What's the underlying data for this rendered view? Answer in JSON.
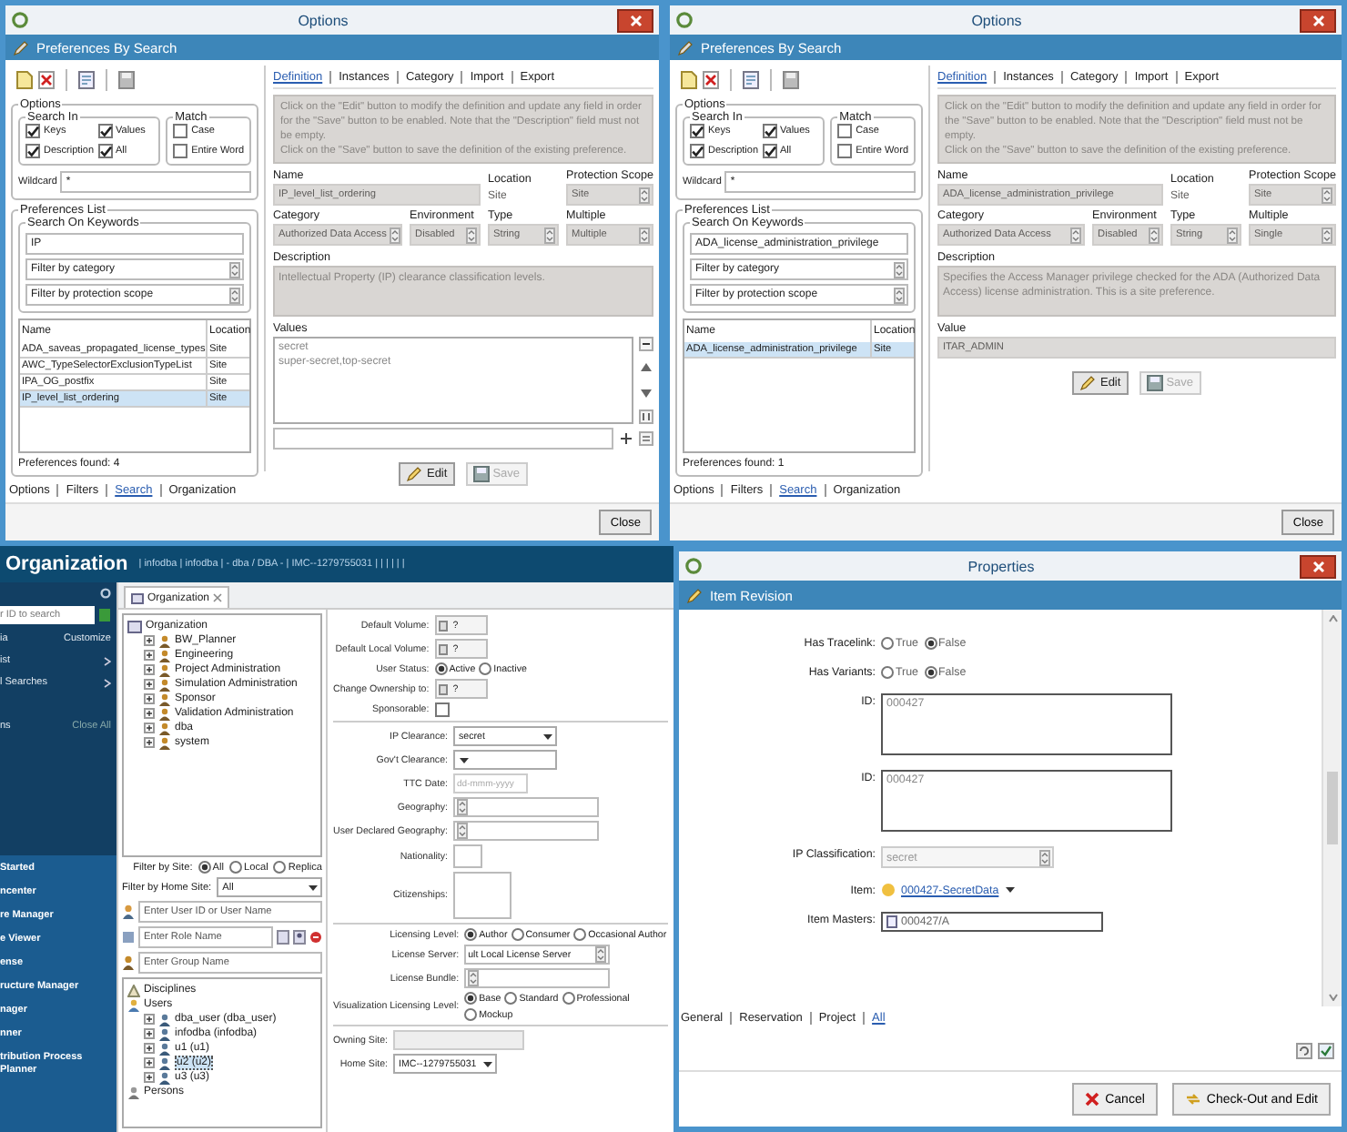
{
  "options_dialogs": [
    {
      "title": "Options",
      "header": "Preferences By Search",
      "options": {
        "legend": "Options",
        "search_in": {
          "legend": "Search In",
          "checks": [
            {
              "label": "Keys",
              "checked": true
            },
            {
              "label": "Values",
              "checked": true
            },
            {
              "label": "Description",
              "checked": true
            },
            {
              "label": "All",
              "checked": true
            }
          ]
        },
        "match": {
          "legend": "Match",
          "checks": [
            {
              "label": "Case",
              "checked": false
            },
            {
              "label": "Entire Word",
              "checked": false
            }
          ]
        },
        "wildcard": {
          "label": "Wildcard",
          "value": "*"
        }
      },
      "prefs": {
        "legend": "Preferences List",
        "search_legend": "Search On Keywords",
        "keyword": "IP",
        "filters": [
          "Filter by category",
          "Filter by protection scope"
        ],
        "columns": [
          "Name",
          "Location"
        ],
        "rows": [
          {
            "name": "ADA_saveas_propagated_license_types",
            "location": "Site",
            "selected": false
          },
          {
            "name": "AWC_TypeSelectorExclusionTypeList",
            "location": "Site",
            "selected": false
          },
          {
            "name": "IPA_OG_postfix",
            "location": "Site",
            "selected": false
          },
          {
            "name": "IP_level_list_ordering",
            "location": "Site",
            "selected": true
          }
        ],
        "found": "Preferences found: 4"
      },
      "tabs": [
        {
          "label": "Definition",
          "selected": true
        },
        {
          "label": "Instances",
          "selected": false
        },
        {
          "label": "Category",
          "selected": false
        },
        {
          "label": "Import",
          "selected": false
        },
        {
          "label": "Export",
          "selected": false
        }
      ],
      "info": [
        "Click on the \"Edit\" button to modify the definition and update any field in order for the \"Save\" button to be enabled. Note that the \"Description\" field must not be empty.",
        "Click on the \"Save\" button to save the definition of the existing preference."
      ],
      "field_rows": [
        [
          {
            "label": "Name",
            "value": "IP_level_list_ordering",
            "kind": "input"
          },
          {
            "label": "Location",
            "value": "Site",
            "kind": "text"
          },
          {
            "label": "Protection Scope",
            "value": "Site",
            "kind": "select"
          }
        ],
        [
          {
            "label": "Category",
            "value": "Authorized Data Access",
            "kind": "select"
          },
          {
            "label": "Environment",
            "value": "Disabled",
            "kind": "select"
          },
          {
            "label": "Type",
            "value": "String",
            "kind": "select"
          },
          {
            "label": "Multiple",
            "value": "Multiple",
            "kind": "select"
          }
        ]
      ],
      "description": {
        "label": "Description",
        "text": "Intellectual Property (IP) clearance classification levels."
      },
      "values": {
        "kind": "list",
        "label": "Values",
        "items": [
          "secret",
          "super-secret,top-secret"
        ]
      },
      "buttons": [
        {
          "kind": "edit",
          "label": "Edit",
          "disabled": false
        },
        {
          "kind": "save",
          "label": "Save",
          "disabled": true
        }
      ],
      "bottom_tabs": [
        {
          "label": "Options",
          "selected": false
        },
        {
          "label": "Filters",
          "selected": false
        },
        {
          "label": "Search",
          "selected": true
        },
        {
          "label": "Organization",
          "selected": false
        }
      ],
      "close": "Close"
    },
    {
      "title": "Options",
      "header": "Preferences By Search",
      "options": {
        "legend": "Options",
        "search_in": {
          "legend": "Search In",
          "checks": [
            {
              "label": "Keys",
              "checked": true
            },
            {
              "label": "Values",
              "checked": true
            },
            {
              "label": "Description",
              "checked": true
            },
            {
              "label": "All",
              "checked": true
            }
          ]
        },
        "match": {
          "legend": "Match",
          "checks": [
            {
              "label": "Case",
              "checked": false
            },
            {
              "label": "Entire Word",
              "checked": false
            }
          ]
        },
        "wildcard": {
          "label": "Wildcard",
          "value": "*"
        }
      },
      "prefs": {
        "legend": "Preferences List",
        "search_legend": "Search On Keywords",
        "keyword": "ADA_license_administration_privilege",
        "filters": [
          "Filter by category",
          "Filter by protection scope"
        ],
        "columns": [
          "Name",
          "Location"
        ],
        "rows": [
          {
            "name": "ADA_license_administration_privilege",
            "location": "Site",
            "selected": true
          }
        ],
        "found": "Preferences found: 1"
      },
      "tabs": [
        {
          "label": "Definition",
          "selected": true
        },
        {
          "label": "Instances",
          "selected": false
        },
        {
          "label": "Category",
          "selected": false
        },
        {
          "label": "Import",
          "selected": false
        },
        {
          "label": "Export",
          "selected": false
        }
      ],
      "info": [
        "Click on the \"Edit\" button to modify the definition and update any field in order for the \"Save\" button to be enabled. Note that the \"Description\" field must not be empty.",
        "Click on the \"Save\" button to save the definition of the existing preference."
      ],
      "field_rows": [
        [
          {
            "label": "Name",
            "value": "ADA_license_administration_privilege",
            "kind": "input"
          },
          {
            "label": "Location",
            "value": "Site",
            "kind": "text"
          },
          {
            "label": "Protection Scope",
            "value": "Site",
            "kind": "select"
          }
        ],
        [
          {
            "label": "Category",
            "value": "Authorized Data Access",
            "kind": "select"
          },
          {
            "label": "Environment",
            "value": "Disabled",
            "kind": "select"
          },
          {
            "label": "Type",
            "value": "String",
            "kind": "select"
          },
          {
            "label": "Multiple",
            "value": "Single",
            "kind": "select"
          }
        ]
      ],
      "description": {
        "label": "Description",
        "text": "Specifies the Access Manager privilege checked for the ADA (Authorized Data Access) license administration. This is a site preference."
      },
      "values": {
        "kind": "single",
        "label": "Value",
        "text": "ITAR_ADMIN"
      },
      "buttons": [
        {
          "kind": "edit",
          "label": "Edit",
          "disabled": false
        },
        {
          "kind": "save",
          "label": "Save",
          "disabled": true
        }
      ],
      "bottom_tabs": [
        {
          "label": "Options",
          "selected": false
        },
        {
          "label": "Filters",
          "selected": false
        },
        {
          "label": "Search",
          "selected": true
        },
        {
          "label": "Organization",
          "selected": false
        }
      ],
      "close": "Close"
    }
  ],
  "organization": {
    "title": "Organization",
    "context": "| infodba | infodba | - dba / DBA - | IMC--1279755031 | | | | | |",
    "nav": {
      "search_placeholder": "r ID to search",
      "header": {
        "label": "ia",
        "action": "Customize"
      },
      "items": [
        "ist",
        "l Searches"
      ],
      "footer": {
        "label": "ns",
        "action": "Close All"
      },
      "apps": [
        "Started",
        "ncenter",
        "re Manager",
        "e Viewer",
        "ense",
        "ructure Manager",
        "nager",
        "nner",
        "tribution Process Planner"
      ]
    },
    "tab": "Organization",
    "tree": {
      "label": "Organization",
      "kind": "root",
      "selected": false,
      "children": [
        {
          "label": "BW_Planner",
          "kind": "group",
          "expanded": false,
          "selected": false
        },
        {
          "label": "Engineering",
          "kind": "group",
          "expanded": false,
          "selected": false
        },
        {
          "label": "Project Administration",
          "kind": "group",
          "expanded": false,
          "selected": false
        },
        {
          "label": "Simulation Administration",
          "kind": "group",
          "expanded": false,
          "selected": false
        },
        {
          "label": "Sponsor",
          "kind": "group",
          "expanded": false,
          "selected": false
        },
        {
          "label": "Validation Administration",
          "kind": "group",
          "expanded": false,
          "selected": false
        },
        {
          "label": "dba",
          "kind": "group",
          "expanded": false,
          "selected": false
        },
        {
          "label": "system",
          "kind": "group",
          "expanded": false,
          "selected": false
        }
      ]
    },
    "site_filter": {
      "label": "Filter by Site:",
      "options": [
        {
          "label": "All",
          "selected": true
        },
        {
          "label": "Local",
          "selected": false
        },
        {
          "label": "Replica",
          "selected": false
        }
      ]
    },
    "home_site": {
      "label": "Filter by Home Site:",
      "value": "All"
    },
    "search_fields": [
      {
        "kind": "user",
        "placeholder": "Enter User ID or User Name"
      },
      {
        "kind": "role",
        "placeholder": "Enter Role Name"
      },
      {
        "kind": "group",
        "placeholder": "Enter Group Name"
      }
    ],
    "list": [
      {
        "label": "Disciplines",
        "kind": "discipline",
        "selected": false
      },
      {
        "label": "Users",
        "kind": "users",
        "selected": false,
        "children": [
          {
            "label": "dba_user (dba_user)",
            "kind": "user",
            "expanded": false,
            "selected": false
          },
          {
            "label": "infodba (infodba)",
            "kind": "user",
            "expanded": false,
            "selected": false
          },
          {
            "label": "u1 (u1)",
            "kind": "user",
            "expanded": false,
            "selected": false
          },
          {
            "label": "u2 (u2)",
            "kind": "user",
            "expanded": false,
            "selected": true
          },
          {
            "label": "u3 (u3)",
            "kind": "user",
            "expanded": false,
            "selected": false
          }
        ]
      },
      {
        "label": "Persons",
        "kind": "persons",
        "selected": false
      }
    ],
    "form_sections": [
      [
        {
          "kind": "picker",
          "label": "Default Volume:",
          "value": "?"
        },
        {
          "kind": "picker",
          "label": "Default Local Volume:",
          "value": "?"
        },
        {
          "kind": "radios",
          "label": "User Status:",
          "options": [
            {
              "label": "Active",
              "selected": true
            },
            {
              "label": "Inactive",
              "selected": false
            }
          ]
        },
        {
          "kind": "picker",
          "label": "Change Ownership to:",
          "value": "?"
        },
        {
          "kind": "checkbox",
          "label": "Sponsorable:",
          "checked": false
        }
      ],
      [
        {
          "kind": "select",
          "label": "IP Clearance:",
          "value": "secret"
        },
        {
          "kind": "select",
          "label": "Gov't Clearance:"
        },
        {
          "kind": "date",
          "label": "TTC Date:",
          "placeholder": "dd-mmm-yyyy"
        },
        {
          "kind": "combo",
          "label": "Geography:"
        },
        {
          "kind": "combo",
          "label": "User Declared Geography:"
        },
        {
          "kind": "blank",
          "label": "Nationality:"
        },
        {
          "kind": "list",
          "label": "Citizenships:"
        }
      ],
      [
        {
          "kind": "radios",
          "label": "Licensing Level:",
          "options": [
            {
              "label": "Author",
              "selected": true
            },
            {
              "label": "Consumer",
              "selected": false
            },
            {
              "label": "Occasional Author",
              "selected": false
            }
          ]
        },
        {
          "kind": "combo",
          "label": "License Server:",
          "value": "ult Local License Server"
        },
        {
          "kind": "combo",
          "label": "License Bundle:"
        },
        {
          "kind": "radios",
          "label": "Visualization Licensing Level:",
          "options": [
            {
              "label": "Base",
              "selected": true
            },
            {
              "label": "Standard",
              "selected": false
            },
            {
              "label": "Professional",
              "selected": false
            },
            {
              "label": "Mockup",
              "selected": false
            }
          ]
        }
      ],
      [
        {
          "kind": "readonly",
          "label": "Owning Site:"
        },
        {
          "kind": "select",
          "label": "Home Site:",
          "value": "IMC--1279755031"
        }
      ]
    ]
  },
  "properties": {
    "title": "Properties",
    "header": "Item Revision",
    "rows": [
      {
        "kind": "radios",
        "label": "Has Tracelink:",
        "options": [
          {
            "label": "True",
            "selected": false
          },
          {
            "label": "False",
            "selected": true
          }
        ]
      },
      {
        "kind": "radios",
        "label": "Has Variants:",
        "options": [
          {
            "label": "True",
            "selected": false
          },
          {
            "label": "False",
            "selected": true
          }
        ]
      },
      {
        "kind": "textarea",
        "label": "ID:",
        "value": "000427"
      },
      {
        "kind": "textarea",
        "label": "ID:",
        "value": "000427"
      },
      {
        "kind": "select",
        "label": "IP Classification:",
        "value": "secret"
      },
      {
        "kind": "link",
        "label": "Item:",
        "value": "000427-SecretData"
      },
      {
        "kind": "input",
        "label": "Item Masters:",
        "value": "000427/A"
      }
    ],
    "tabs": [
      {
        "label": "General",
        "selected": false
      },
      {
        "label": "Reservation",
        "selected": false
      },
      {
        "label": "Project",
        "selected": false
      },
      {
        "label": "All",
        "selected": true
      }
    ],
    "buttons": [
      {
        "kind": "cancel",
        "label": "Cancel"
      },
      {
        "kind": "checkout",
        "label": "Check-Out and Edit"
      }
    ]
  }
}
